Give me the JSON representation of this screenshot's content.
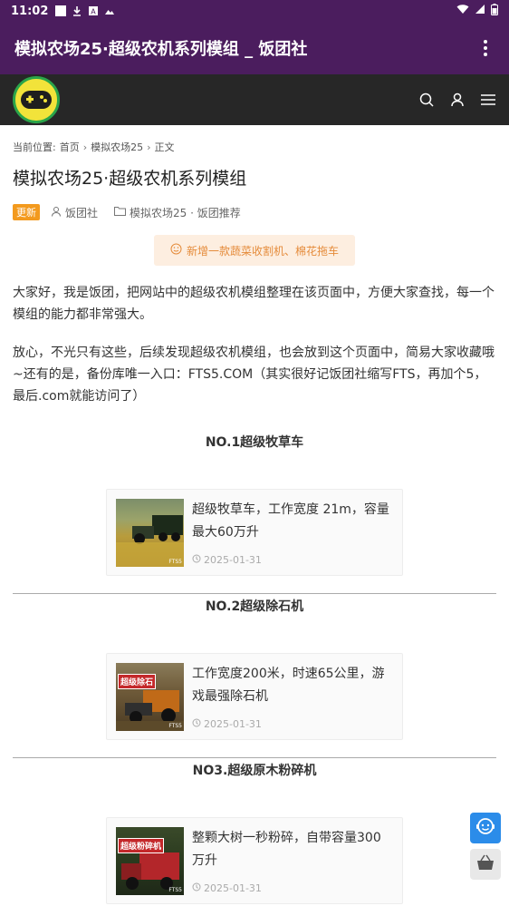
{
  "status": {
    "time": "11:02"
  },
  "appbar": {
    "title": "模拟农场25·超级农机系列模组 _ 饭团社"
  },
  "breadcrumb": {
    "prefix": "当前位置:",
    "items": [
      "首页",
      "模拟农场25",
      "正文"
    ]
  },
  "article": {
    "title": "模拟农场25·超级农机系列模组",
    "badge": "更新",
    "author": "饭团社",
    "category": "模拟农场25 · 饭团推荐",
    "notice": "新增一款蔬菜收割机、棉花拖车",
    "para1": "大家好，我是饭团，把网站中的超级农机模组整理在该页面中，方便大家查找，每一个模组的能力都非常强大。",
    "para2": "放心，不光只有这些，后续发现超级农机模组，也会放到这个页面中，简易大家收藏哦~还有的是，备份库唯一入口：FTS5.COM（其实很好记饭团社缩写FTS，再加个5，最后.com就能访问了）"
  },
  "sections": [
    {
      "heading": "NO.1超级牧草车",
      "desc": "超级牧草车，工作宽度 21m，容量最大60万升",
      "date": "2025-01-31",
      "thumb_label": "",
      "thumb_wm": "FTS5"
    },
    {
      "heading": "NO.2超级除石机",
      "desc": "工作宽度200米，时速65公里，游戏最强除石机",
      "date": "2025-01-31",
      "thumb_label": "超级除石",
      "thumb_wm": "FTS5"
    },
    {
      "heading": "NO3.超级原木粉碎机",
      "desc": "整颗大树一秒粉碎，自带容量300万升",
      "date": "2025-01-31",
      "thumb_label": "超级粉碎机",
      "thumb_wm": "FTS5"
    }
  ],
  "colors": {
    "appbar": "#4b1d5e",
    "sitebar": "#272727",
    "badge": "#f39a1e",
    "notice_text": "#e58b3a",
    "chat": "#2b8ce9"
  }
}
